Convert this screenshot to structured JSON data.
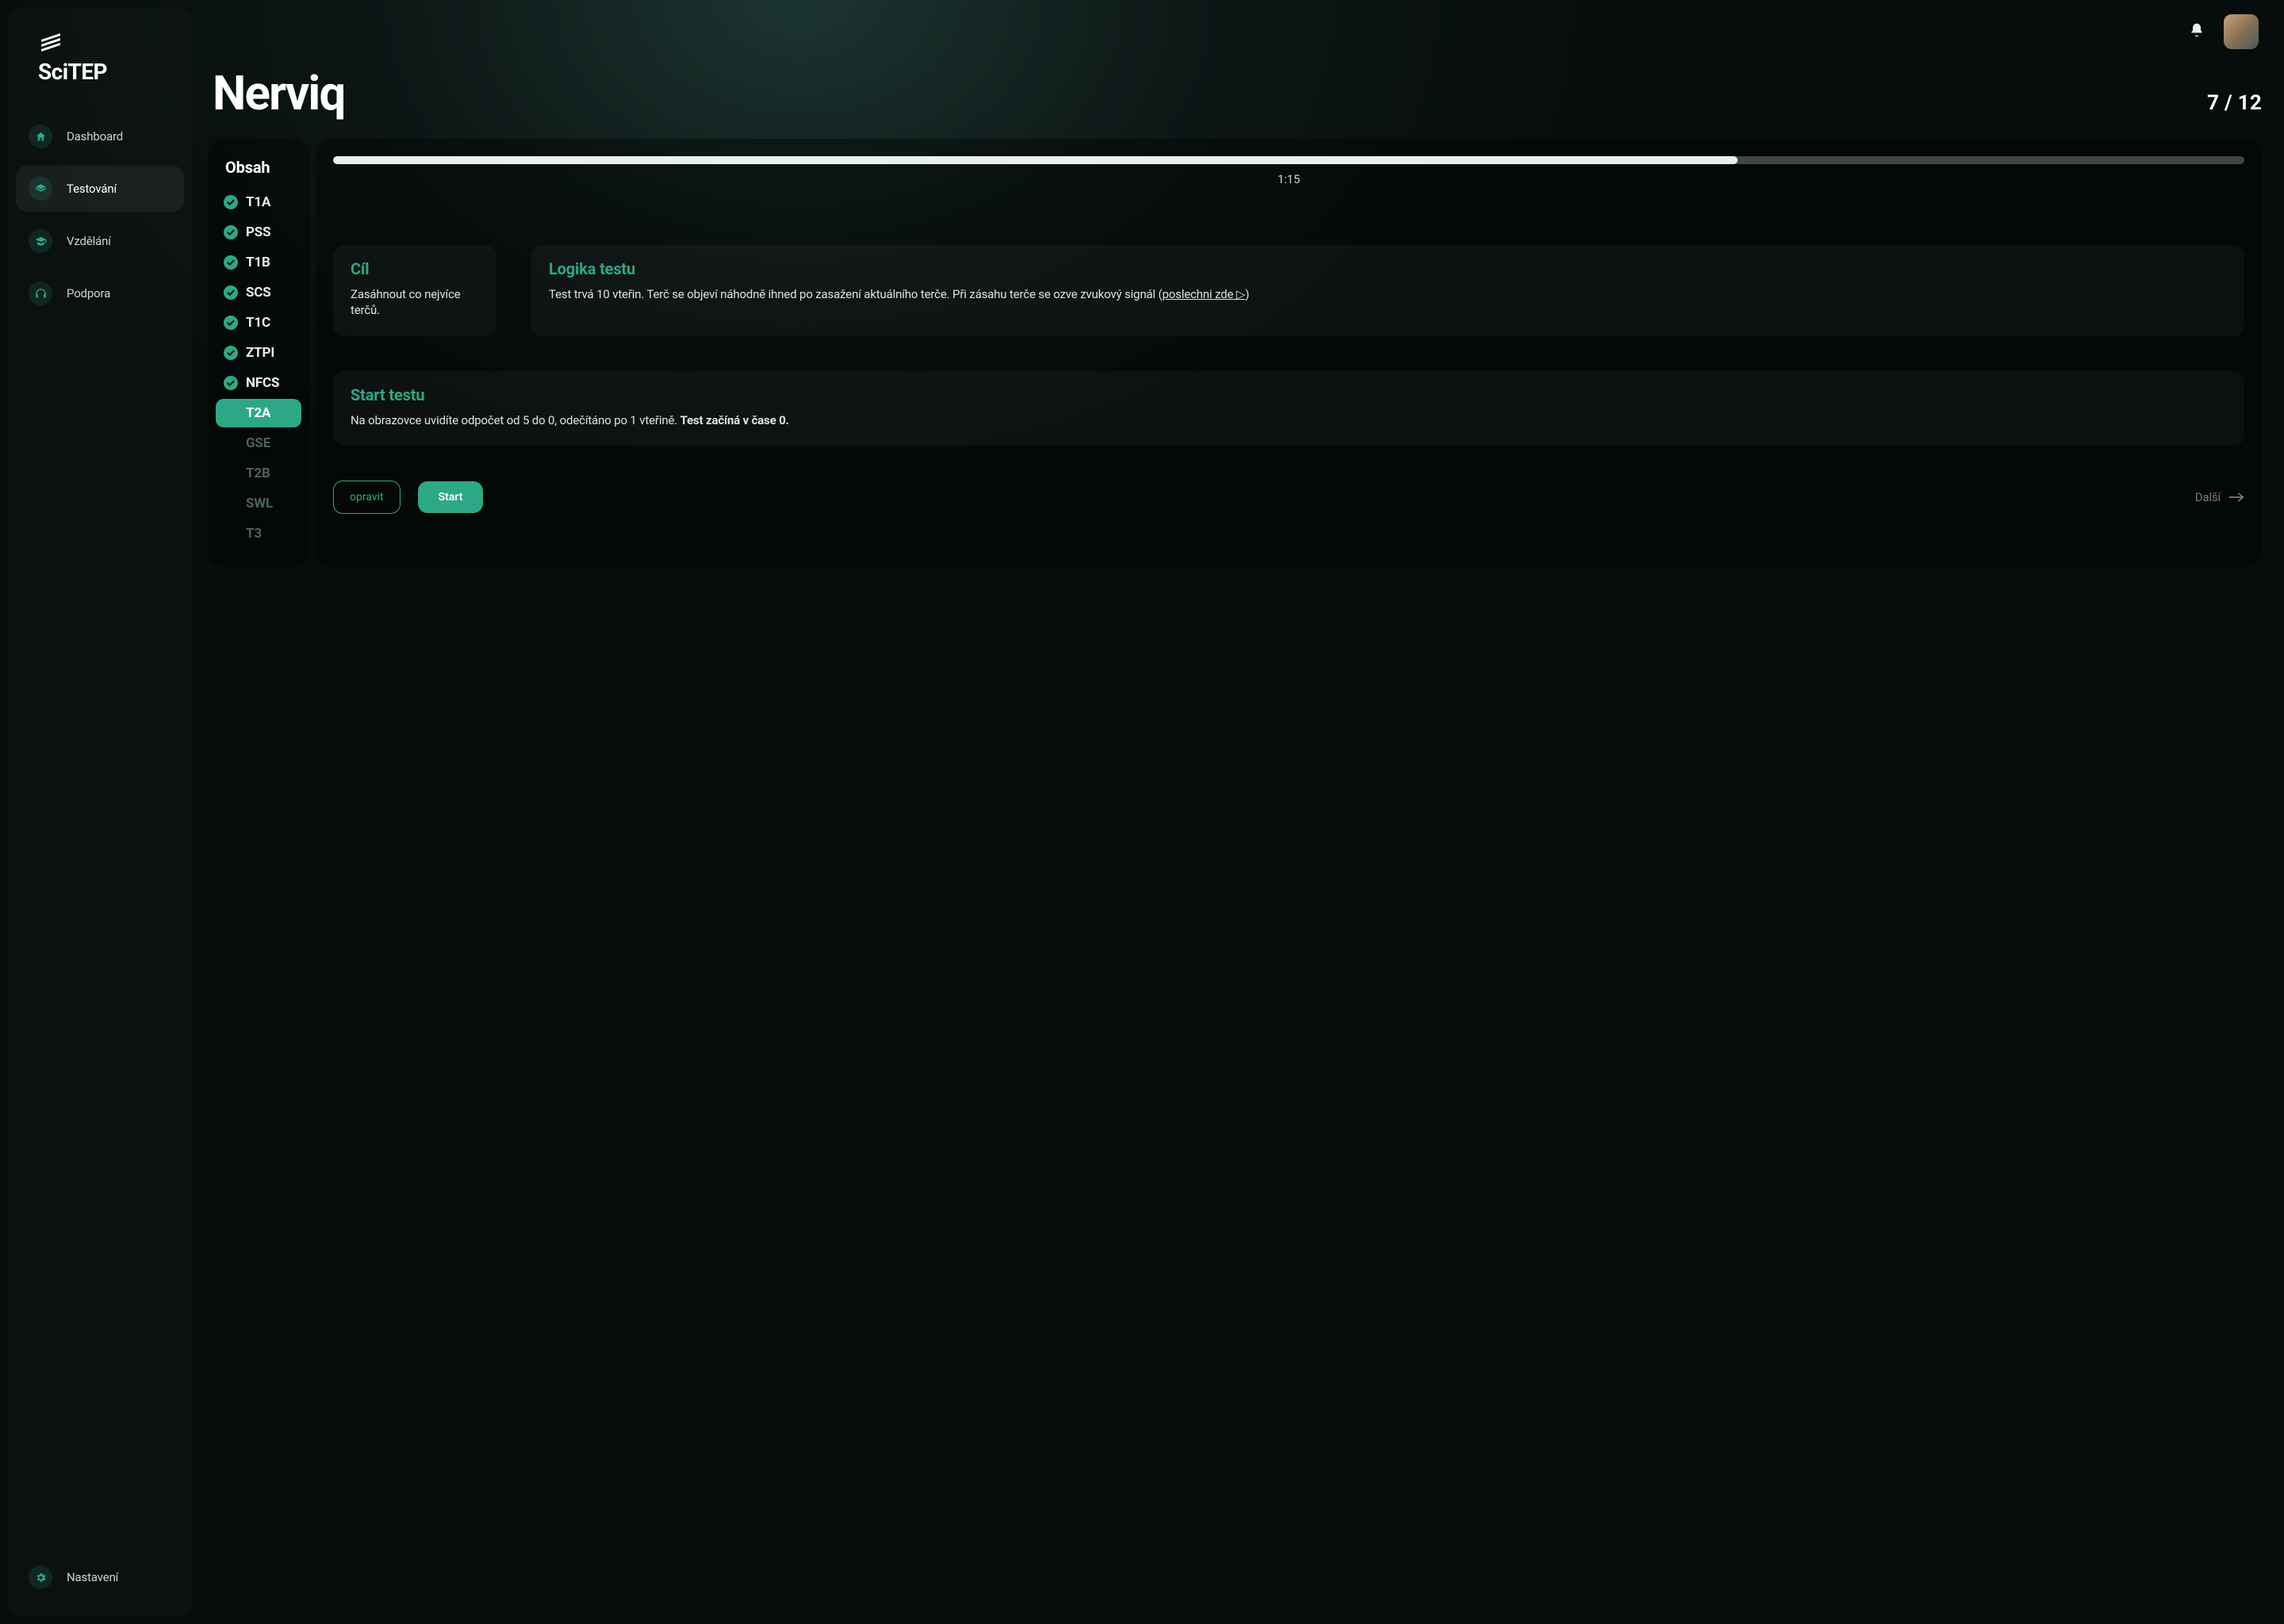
{
  "brand": {
    "name": "SciTEP"
  },
  "nav": {
    "items": [
      {
        "label": "Dashboard",
        "icon": "home"
      },
      {
        "label": "Testování",
        "icon": "stack"
      },
      {
        "label": "Vzdělání",
        "icon": "grad"
      },
      {
        "label": "Podpora",
        "icon": "headphones"
      }
    ],
    "settings_label": "Nastavení"
  },
  "page": {
    "title": "Nerviq",
    "counter": "7 / 12"
  },
  "contents": {
    "title": "Obsah",
    "items": [
      {
        "code": "T1A",
        "state": "done"
      },
      {
        "code": "PSS",
        "state": "done"
      },
      {
        "code": "T1B",
        "state": "done"
      },
      {
        "code": "SCS",
        "state": "done"
      },
      {
        "code": "T1C",
        "state": "done"
      },
      {
        "code": "ZTPI",
        "state": "done"
      },
      {
        "code": "NFCS",
        "state": "done"
      },
      {
        "code": "T2A",
        "state": "active"
      },
      {
        "code": "GSE",
        "state": "pending"
      },
      {
        "code": "T2B",
        "state": "pending"
      },
      {
        "code": "SWL",
        "state": "pending"
      },
      {
        "code": "T3",
        "state": "pending"
      }
    ]
  },
  "timer": "1:15",
  "progress_percent": 73.5,
  "goal": {
    "heading": "Cíl",
    "body": "Zasáhnout co nejvíce terčů."
  },
  "logic": {
    "heading": "Logika testu",
    "body_prefix": "Test trvá 10 vteřin. Terč se objeví náhodně ihned po zasažení aktuálního terče. Při zásahu terče se ozve zvukový signál (",
    "listen_label": "poslechni zde ▷",
    "body_suffix": ")"
  },
  "start": {
    "heading": "Start testu",
    "body_prefix": "Na obrazovce uvidíte odpočet od 5 do 0, odečítáno po 1 vteřině. ",
    "body_strong": "Test začíná v čase 0."
  },
  "actions": {
    "correct": "opravit",
    "start": "Start",
    "next": "Další"
  }
}
